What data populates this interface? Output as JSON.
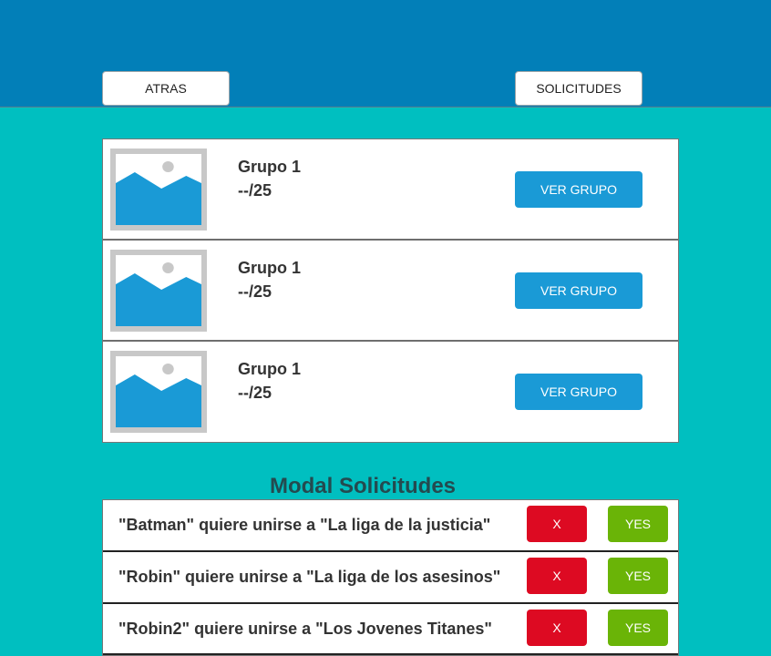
{
  "header": {
    "back_label": "ATRAS",
    "requests_label": "SOLICITUDES"
  },
  "groups": [
    {
      "name": "Grupo 1",
      "count": "--/25",
      "button": "VER GRUPO",
      "icon": "image-placeholder-icon"
    },
    {
      "name": "Grupo 1",
      "count": "--/25",
      "button": "VER GRUPO",
      "icon": "image-placeholder-icon"
    },
    {
      "name": "Grupo 1",
      "count": "--/25",
      "button": "VER GRUPO",
      "icon": "image-placeholder-icon"
    }
  ],
  "modal": {
    "title": "Modal Solicitudes",
    "requests": [
      {
        "text": "\"Batman\" quiere unirse a \"La liga de la justicia\"",
        "reject": "X",
        "accept": "YES"
      },
      {
        "text": "\"Robin\" quiere unirse a \"La liga de los asesinos\"",
        "reject": "X",
        "accept": "YES"
      },
      {
        "text": "\"Robin2\" quiere unirse a \"Los Jovenes Titanes\"",
        "reject": "X",
        "accept": "YES"
      }
    ]
  },
  "colors": {
    "header": "#027fb8",
    "background": "#00bfc0",
    "primary_button": "#1a9ad6",
    "reject_button": "#dd0a22",
    "accept_button": "#6ab407"
  }
}
